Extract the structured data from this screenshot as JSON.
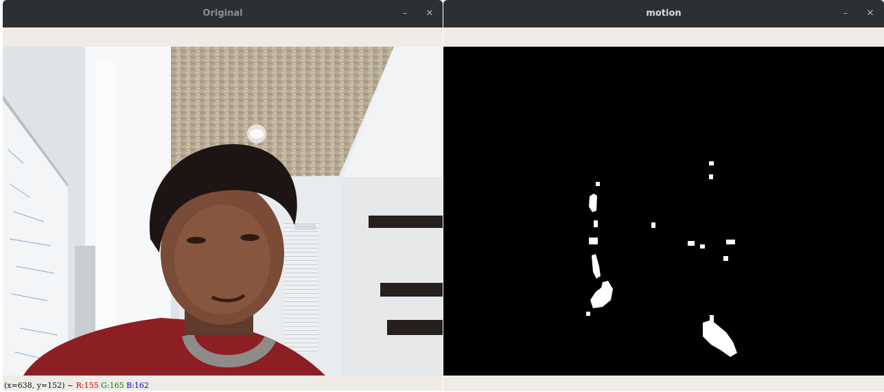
{
  "windows": {
    "original": {
      "title": "Original",
      "minimize_icon": "minimize-icon",
      "close_icon": "close-icon",
      "status": {
        "coords": "(x=638, y=152) ~",
        "r": "R:155",
        "g": "G:165",
        "b": "B:162"
      }
    },
    "motion": {
      "title": "motion",
      "minimize_icon": "minimize-icon",
      "close_icon": "close-icon"
    }
  },
  "glyphs": {
    "minimize": "–",
    "close": "✕"
  },
  "colors": {
    "titlebar": "#2d3033",
    "toolbar": "#efebe7",
    "motion_background": "#000000",
    "motion_foreground": "#ffffff"
  }
}
